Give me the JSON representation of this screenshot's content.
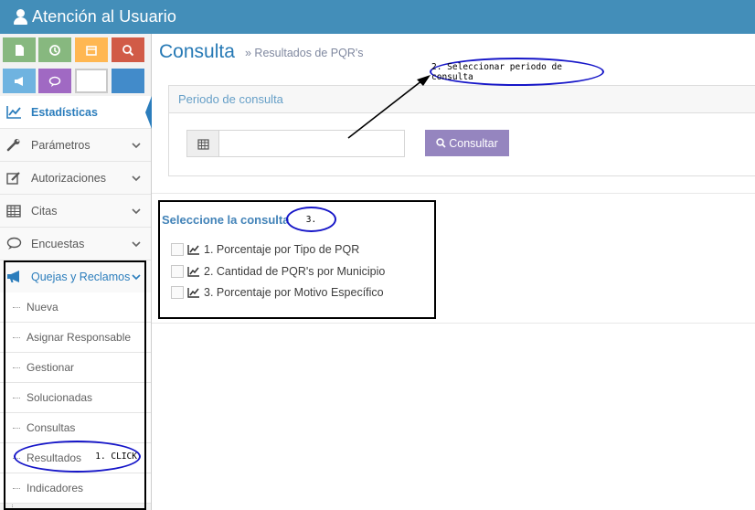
{
  "header": {
    "title": "Atención al Usuario",
    "icon": "user-icon",
    "color": "#438eb9"
  },
  "shortcuts": [
    {
      "icon": "file-icon",
      "color": "#87b87f"
    },
    {
      "icon": "history-icon",
      "color": "#87b87f"
    },
    {
      "icon": "calendar-icon",
      "color": "#ffb752"
    },
    {
      "icon": "search-icon",
      "color": "#d15b47"
    },
    {
      "icon": "bullhorn-icon",
      "color": "#6fb3e0"
    },
    {
      "icon": "comment-icon",
      "color": "#a069c3"
    },
    {
      "icon": "blank-tile",
      "color": "#ffffff"
    },
    {
      "icon": "blank-tile",
      "color": "#428bca"
    }
  ],
  "sidebar": {
    "items": [
      {
        "label": "Estadísticas",
        "icon": "line-chart-icon",
        "active": true
      },
      {
        "label": "Parámetros",
        "icon": "wrench-icon"
      },
      {
        "label": "Autorizaciones",
        "icon": "edit-icon"
      },
      {
        "label": "Citas",
        "icon": "calendar-icon"
      },
      {
        "label": "Encuestas",
        "icon": "comment-icon"
      },
      {
        "label": "Quejas y Reclamos",
        "icon": "bullhorn-icon",
        "open": true
      }
    ],
    "subitems": [
      "Nueva",
      "Asignar Responsable",
      "Gestionar",
      "Solucionadas",
      "Consultas",
      "Resultados",
      "Indicadores"
    ]
  },
  "page": {
    "title": "Consulta",
    "subtitle": "» Resultados de PQR's"
  },
  "periodo": {
    "heading": "Periodo de consulta",
    "date_value": "",
    "button_label": "Consultar"
  },
  "consulta": {
    "heading": "Seleccione la consulta",
    "options": [
      "1. Porcentaje por Tipo de PQR",
      "2. Cantidad de PQR's por Municipio",
      "3. Porcentaje por Motivo Específico"
    ]
  },
  "annotations": {
    "step1": "1. CLICK",
    "step2": "2. Seleccionar periodo de consulta",
    "step3": "3."
  }
}
